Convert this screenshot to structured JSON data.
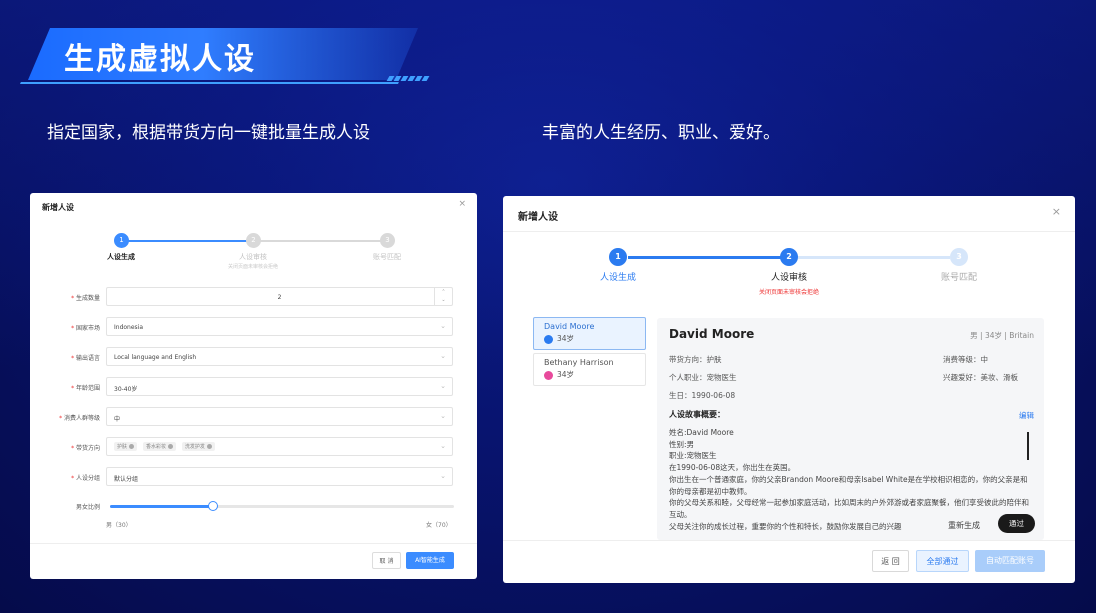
{
  "slide": {
    "title": "生成虚拟人设",
    "subtitle_left": "指定国家，根据带货方向一键批量生成人设",
    "subtitle_right": "丰富的人生经历、职业、爱好。"
  },
  "panel_left": {
    "title": "新增人设",
    "close": "×",
    "steps": [
      {
        "num": "1",
        "label": "人设生成",
        "state": "active"
      },
      {
        "num": "2",
        "label": "人设审核",
        "hint": "关闭页面未审核会拒绝",
        "state": "pending"
      },
      {
        "num": "3",
        "label": "账号匹配",
        "state": "pending"
      }
    ],
    "form": {
      "count_label": "生成数量",
      "count_value": "2",
      "market_label": "国家市场",
      "market_value": "Indonesia",
      "language_label": "输出语言",
      "language_value": "Local language and English",
      "age_label": "年龄范围",
      "age_value": "30-40岁",
      "consumer_label": "消费人群等级",
      "consumer_value": "中",
      "direction_label": "带货方向",
      "direction_tags": [
        "护肤",
        "香水彩妆",
        "洗发护发"
      ],
      "group_label": "人设分组",
      "group_value": "默认分组",
      "ratio_label": "男女比例",
      "ratio_fraction": 0.3,
      "male_label": "男（30）",
      "female_label": "女（70）"
    },
    "buttons": {
      "cancel": "取 消",
      "generate": "AI智能生成"
    }
  },
  "panel_right": {
    "title": "新增人设",
    "close": "×",
    "steps": [
      {
        "num": "1",
        "label": "人设生成",
        "state": "done"
      },
      {
        "num": "2",
        "label": "人设审核",
        "hint": "关闭页面未审核会拒绝",
        "state": "active"
      },
      {
        "num": "3",
        "label": "账号匹配",
        "state": "pending"
      }
    ],
    "persons": [
      {
        "name": "David Moore",
        "age": "34岁",
        "gender_icon": "male-icon",
        "active": true
      },
      {
        "name": "Bethany Harrison",
        "age": "34岁",
        "gender_icon": "female-icon",
        "active": false
      }
    ],
    "detail": {
      "name": "David Moore",
      "meta": "男 | 34岁 | Britain",
      "direction": "带货方向：护肤",
      "consumer_level": "消费等级：中",
      "occupation": "个人职业：宠物医生",
      "hobbies": "兴趣爱好：美妆、滑板",
      "birthday": "生日：1990-06-08",
      "section_title": "人设故事概要：",
      "edit": "编辑",
      "story": [
        "姓名:David Moore",
        "性别:男",
        "职业:宠物医生",
        "在1990-06-08这天，你出生在英国。",
        "你出生在一个普通家庭，你的父亲Brandon Moore和母亲Isabel White是在学校相识相恋的，你的父亲是和你的母亲都是初中教师。",
        "你的父母关系和睦，父母经常一起参加家庭活动，比如周末的户外郊游或者家庭聚餐，他们享受彼此的陪伴和互动。",
        "父母关注你的成长过程，重要你的个性和特长，鼓励你发展自己的兴趣"
      ],
      "regenerate": "重新生成",
      "pass": "通过"
    },
    "buttons": {
      "back": "返 回",
      "pass_all": "全部通过",
      "auto_match": "自动匹配账号"
    }
  },
  "colors": {
    "accent": "#3b8cff",
    "dark": "#1a1a1a",
    "danger": "#e33333"
  }
}
